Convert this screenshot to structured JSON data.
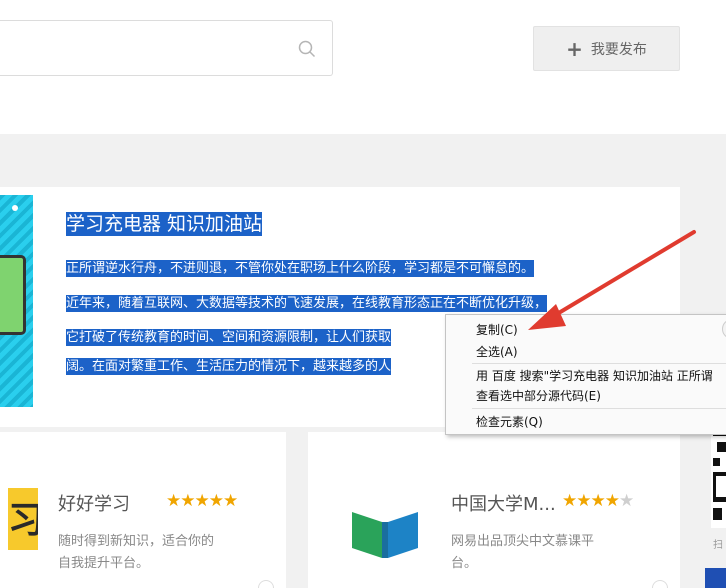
{
  "header": {
    "publish_label": "我要发布"
  },
  "banner": {
    "title": "学习充电器 知识加油站",
    "lines": [
      "正所谓逆水行舟，不进则退，不管你处在职场上什么阶段，学习都是不可懈怠的。",
      "近年来，随着互联网、大数据等技术的飞速发展，在线教育形态正在不断优化升级，",
      "它打破了传统教育的时间、空间和资源限制，让人们获取",
      "阔。在面对繁重工作、生活压力的情况下，越来越多的人"
    ]
  },
  "cards": [
    {
      "title": "好好学习",
      "rating": 5,
      "stars": "★★★★★",
      "desc_lines": [
        "随时得到新知识，适合你的",
        "自我提升平台。"
      ]
    },
    {
      "title": "中国大学M...",
      "rating": 4,
      "stars_on": "★★★★",
      "stars_off": "★",
      "desc_lines": [
        "网易出品顶尖中文慕课平",
        "台。"
      ]
    }
  ],
  "context_menu": {
    "items": [
      "复制(C)",
      "全选(A)",
      "用 百度 搜索\"学习充电器 知识加油站 正所谓",
      "查看选中部分源代码(E)",
      "检查元素(Q)"
    ]
  },
  "sidebar": {
    "qr_caption": "扫"
  },
  "colors": {
    "selection": "#1c62c8",
    "star": "#f0a500",
    "arrow": "#e03b2f"
  }
}
